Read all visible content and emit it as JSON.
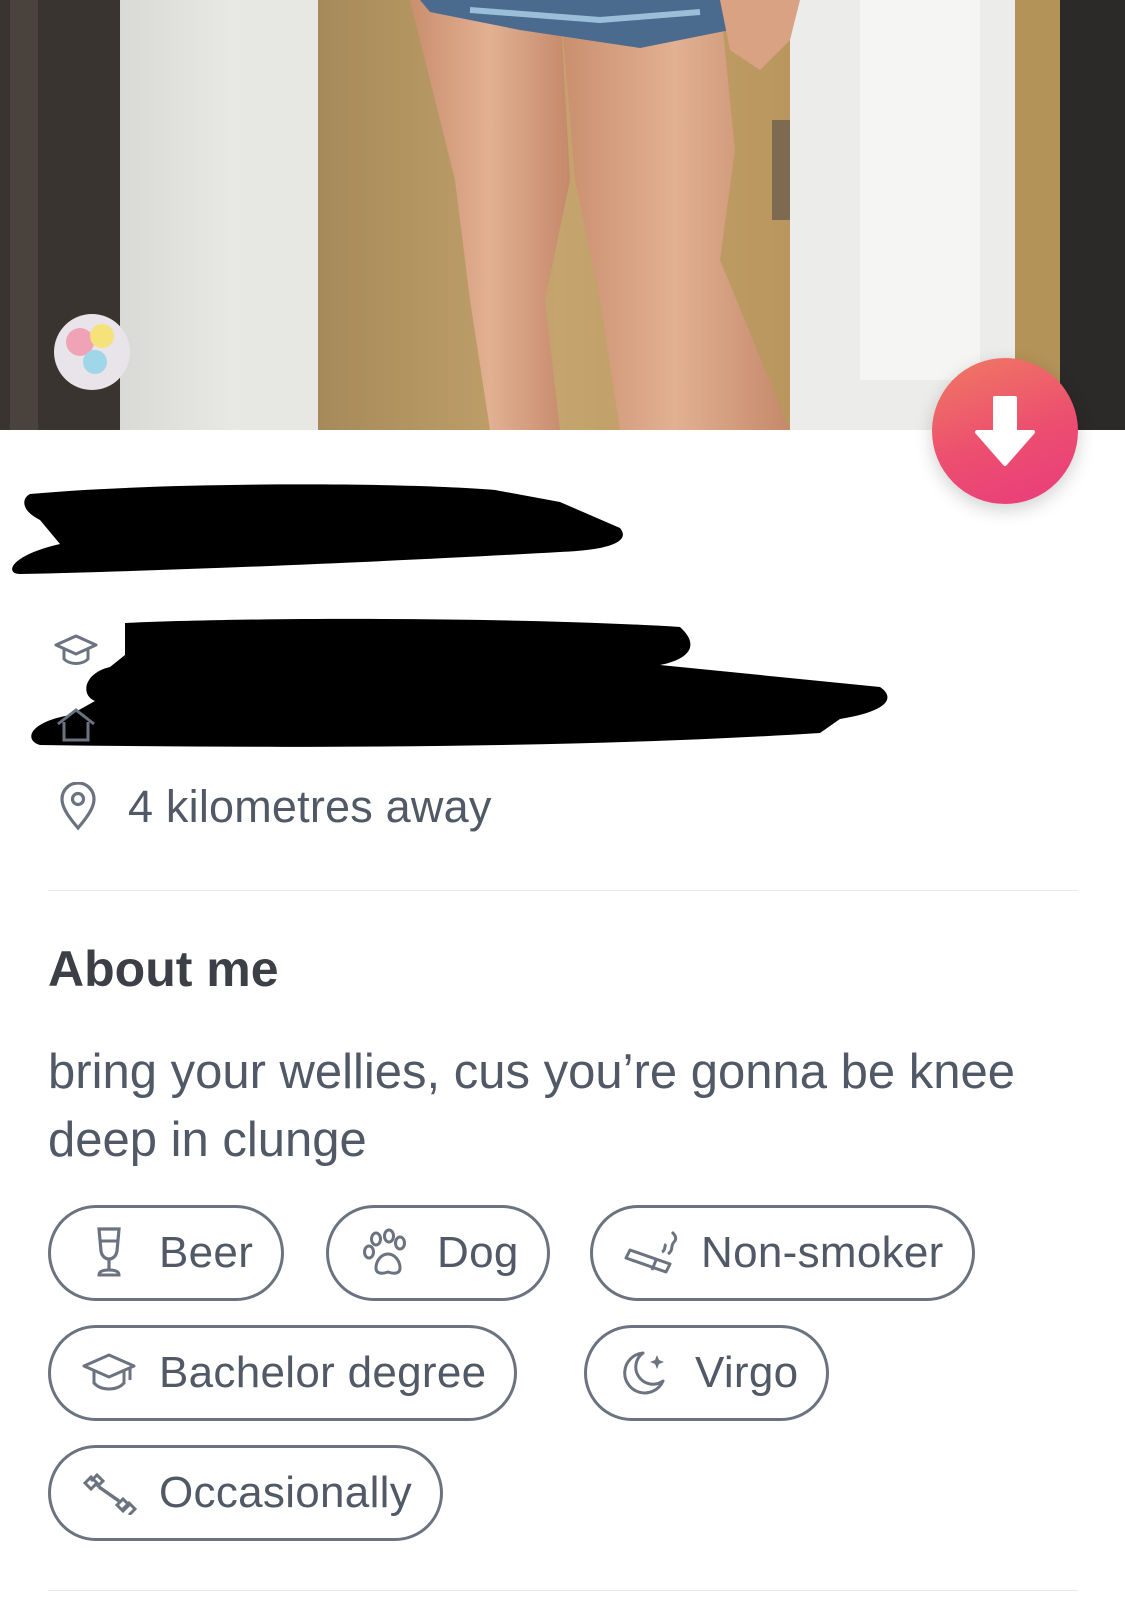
{
  "profile": {
    "collapse_button": "arrow-down-icon",
    "info": {
      "school_icon": "graduation-cap-icon",
      "job_icon": "house-icon",
      "distance_icon": "location-pin-icon",
      "distance": "4 kilometres away"
    },
    "about": {
      "title": "About me",
      "bio": "bring your wellies, cus you’re gonna be knee deep in clunge"
    },
    "chips": [
      {
        "label": "Beer",
        "icon": "wine-glass-icon"
      },
      {
        "label": "Dog",
        "icon": "paw-icon"
      },
      {
        "label": "Non-smoker",
        "icon": "no-smoking-icon"
      },
      {
        "label": "Bachelor degree",
        "icon": "graduation-cap-icon"
      },
      {
        "label": "Virgo",
        "icon": "moon-icon"
      },
      {
        "label": "Occasionally",
        "icon": "dumbbell-icon"
      }
    ]
  },
  "colors": {
    "accent_start": "#f07a63",
    "accent_end": "#e93c7d",
    "text": "#505965",
    "heading": "#3c3f45",
    "chip_border": "#6b7380",
    "divider": "#e6e8eb"
  }
}
